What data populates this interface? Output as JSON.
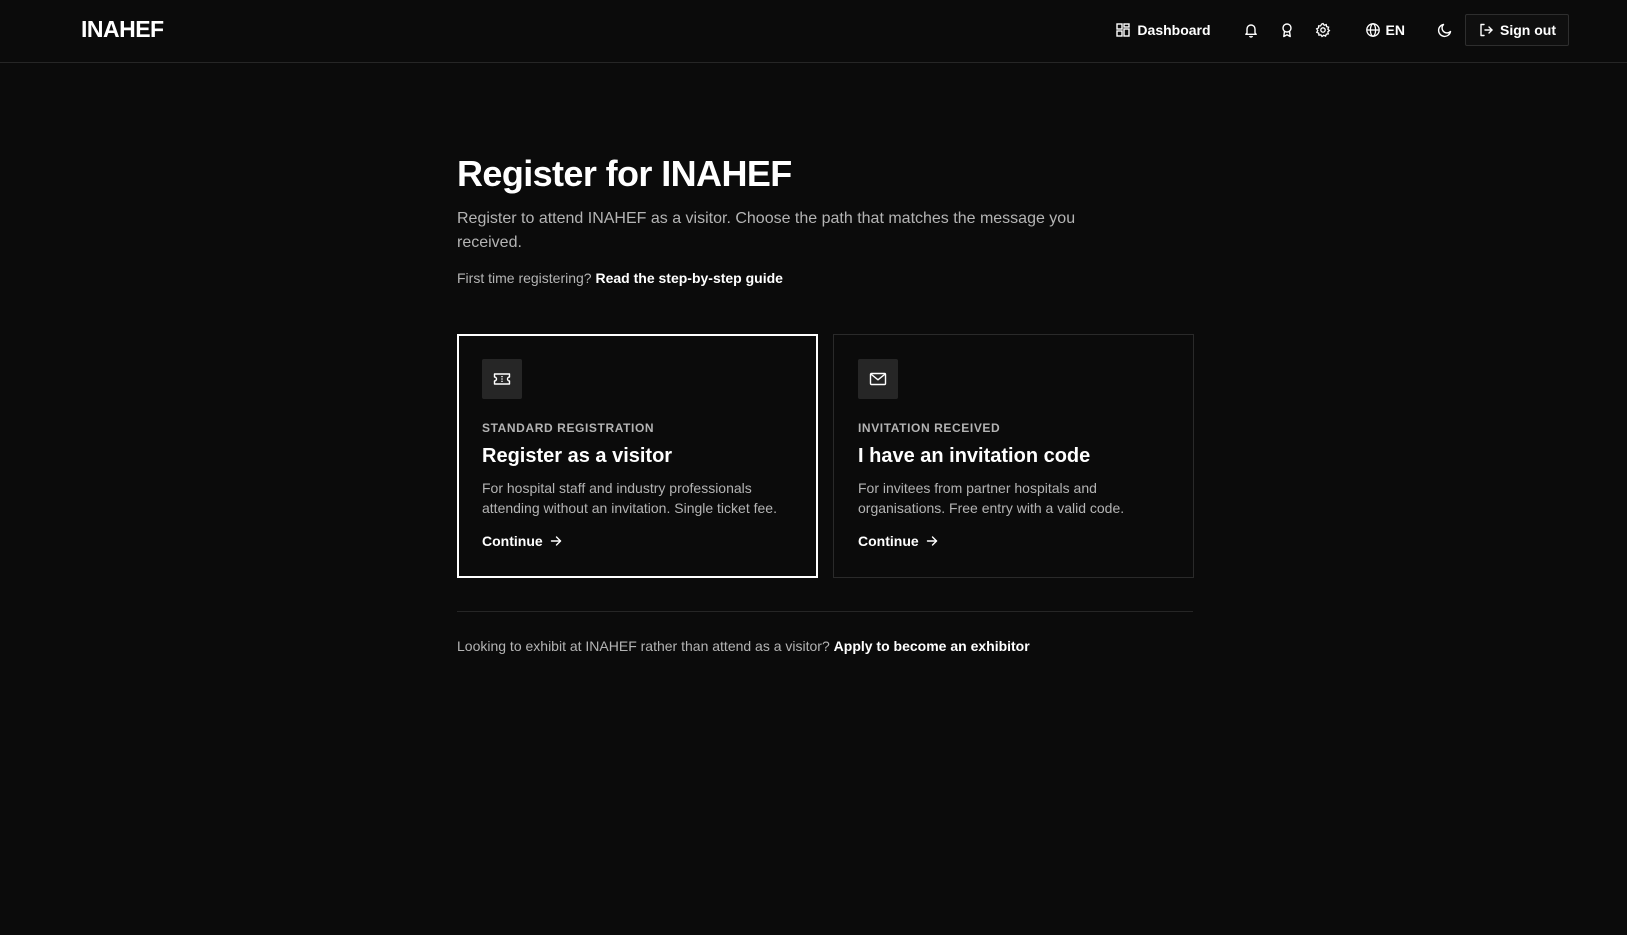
{
  "header": {
    "logo": "INAHEF",
    "dashboard_label": "Dashboard",
    "language_label": "EN",
    "sign_out_label": "Sign out",
    "icons": [
      "dashboard-icon",
      "bell-icon",
      "award-icon",
      "gear-icon",
      "globe-icon",
      "moon-icon",
      "sign-out-icon"
    ]
  },
  "main": {
    "title": "Register for INAHEF",
    "description": "Register to attend INAHEF as a visitor. Choose the path that matches the message you received.",
    "guide_prefix": "First time registering?",
    "guide_link": "Read the step-by-step guide",
    "cards": [
      {
        "icon": "ticket-icon",
        "eyebrow": "STANDARD REGISTRATION",
        "title": "Register as a visitor",
        "description": "For hospital staff and industry professionals attending without an invitation. Single ticket fee.",
        "cta": "Continue",
        "selected": true
      },
      {
        "icon": "mail-icon",
        "eyebrow": "INVITATION RECEIVED",
        "title": "I have an invitation code",
        "description": "For invitees from partner hospitals and organisations. Free entry with a valid code.",
        "cta": "Continue",
        "selected": false
      }
    ],
    "exhibit_prefix": "Looking to exhibit at INAHEF rather than attend as a visitor?",
    "exhibit_link": "Apply to become an exhibitor"
  },
  "colors": {
    "background": "#0b0b0b",
    "text_primary": "#ffffff",
    "text_muted": "#b4b4b4",
    "border": "#2a2a2a",
    "icon_tile": "#262626"
  }
}
